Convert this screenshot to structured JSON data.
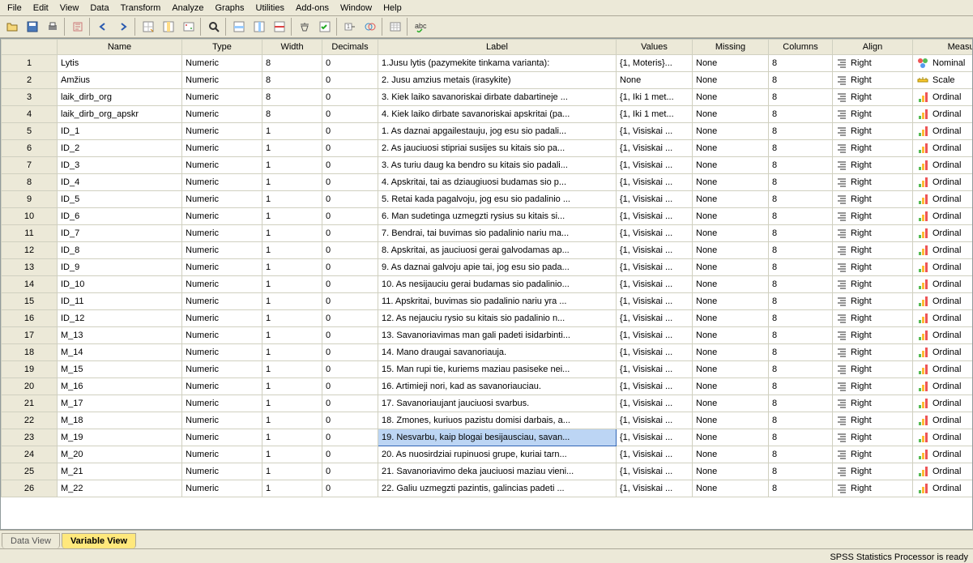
{
  "menu": [
    "File",
    "Edit",
    "View",
    "Data",
    "Transform",
    "Analyze",
    "Graphs",
    "Utilities",
    "Add-ons",
    "Window",
    "Help"
  ],
  "columns": [
    "Name",
    "Type",
    "Width",
    "Decimals",
    "Label",
    "Values",
    "Missing",
    "Columns",
    "Align",
    "Measure"
  ],
  "rows": [
    {
      "n": "1",
      "name": "Lytis",
      "type": "Numeric",
      "width": "8",
      "dec": "0",
      "label": "1.Jusu lytis (pazymekite tinkama varianta):",
      "values": "{1, Moteris}...",
      "missing": "None",
      "cols": "8",
      "align": "Right",
      "measure": "Nominal",
      "micon": "nominal"
    },
    {
      "n": "2",
      "name": "Amžius",
      "type": "Numeric",
      "width": "8",
      "dec": "0",
      "label": "2. Jusu amzius metais (irasykite)",
      "values": "None",
      "missing": "None",
      "cols": "8",
      "align": "Right",
      "measure": "Scale",
      "micon": "scale"
    },
    {
      "n": "3",
      "name": "laik_dirb_org",
      "type": "Numeric",
      "width": "8",
      "dec": "0",
      "label": "3. Kiek laiko savanoriskai dirbate dabartineje ...",
      "values": "{1, Iki 1 met...",
      "missing": "None",
      "cols": "8",
      "align": "Right",
      "measure": "Ordinal",
      "micon": "ordinal"
    },
    {
      "n": "4",
      "name": "laik_dirb_org_apskr",
      "type": "Numeric",
      "width": "8",
      "dec": "0",
      "label": "4. Kiek laiko dirbate savanoriskai apskritai (pa...",
      "values": "{1, Iki 1 met...",
      "missing": "None",
      "cols": "8",
      "align": "Right",
      "measure": "Ordinal",
      "micon": "ordinal"
    },
    {
      "n": "5",
      "name": "ID_1",
      "type": "Numeric",
      "width": "1",
      "dec": "0",
      "label": "1. As daznai apgailestauju, jog esu sio padali...",
      "values": "{1, Visiskai ...",
      "missing": "None",
      "cols": "8",
      "align": "Right",
      "measure": "Ordinal",
      "micon": "ordinal"
    },
    {
      "n": "6",
      "name": "ID_2",
      "type": "Numeric",
      "width": "1",
      "dec": "0",
      "label": "2. As jauciuosi stipriai susijes su kitais sio pa...",
      "values": "{1, Visiskai ...",
      "missing": "None",
      "cols": "8",
      "align": "Right",
      "measure": "Ordinal",
      "micon": "ordinal"
    },
    {
      "n": "7",
      "name": "ID_3",
      "type": "Numeric",
      "width": "1",
      "dec": "0",
      "label": "3. As turiu daug ka bendro su kitais sio padali...",
      "values": "{1, Visiskai ...",
      "missing": "None",
      "cols": "8",
      "align": "Right",
      "measure": "Ordinal",
      "micon": "ordinal"
    },
    {
      "n": "8",
      "name": "ID_4",
      "type": "Numeric",
      "width": "1",
      "dec": "0",
      "label": "4. Apskritai, tai as dziaugiuosi budamas sio p...",
      "values": "{1, Visiskai ...",
      "missing": "None",
      "cols": "8",
      "align": "Right",
      "measure": "Ordinal",
      "micon": "ordinal"
    },
    {
      "n": "9",
      "name": "ID_5",
      "type": "Numeric",
      "width": "1",
      "dec": "0",
      "label": "5. Retai kada pagalvoju, jog esu sio padalinio ...",
      "values": "{1, Visiskai ...",
      "missing": "None",
      "cols": "8",
      "align": "Right",
      "measure": "Ordinal",
      "micon": "ordinal"
    },
    {
      "n": "10",
      "name": "ID_6",
      "type": "Numeric",
      "width": "1",
      "dec": "0",
      "label": "6. Man sudetinga uzmegzti rysius su kitais si...",
      "values": "{1, Visiskai ...",
      "missing": "None",
      "cols": "8",
      "align": "Right",
      "measure": "Ordinal",
      "micon": "ordinal"
    },
    {
      "n": "11",
      "name": "ID_7",
      "type": "Numeric",
      "width": "1",
      "dec": "0",
      "label": "7. Bendrai, tai buvimas sio padalinio nariu ma...",
      "values": "{1, Visiskai ...",
      "missing": "None",
      "cols": "8",
      "align": "Right",
      "measure": "Ordinal",
      "micon": "ordinal"
    },
    {
      "n": "12",
      "name": "ID_8",
      "type": "Numeric",
      "width": "1",
      "dec": "0",
      "label": "8. Apskritai, as jauciuosi gerai galvodamas ap...",
      "values": "{1, Visiskai ...",
      "missing": "None",
      "cols": "8",
      "align": "Right",
      "measure": "Ordinal",
      "micon": "ordinal"
    },
    {
      "n": "13",
      "name": "ID_9",
      "type": "Numeric",
      "width": "1",
      "dec": "0",
      "label": "9. As daznai galvoju apie tai, jog esu sio pada...",
      "values": "{1, Visiskai ...",
      "missing": "None",
      "cols": "8",
      "align": "Right",
      "measure": "Ordinal",
      "micon": "ordinal"
    },
    {
      "n": "14",
      "name": "ID_10",
      "type": "Numeric",
      "width": "1",
      "dec": "0",
      "label": "10. As nesijauciu gerai budamas sio padalinio...",
      "values": "{1, Visiskai ...",
      "missing": "None",
      "cols": "8",
      "align": "Right",
      "measure": "Ordinal",
      "micon": "ordinal"
    },
    {
      "n": "15",
      "name": "ID_11",
      "type": "Numeric",
      "width": "1",
      "dec": "0",
      "label": "11. Apskritai, buvimas sio padalinio nariu yra ...",
      "values": "{1, Visiskai ...",
      "missing": "None",
      "cols": "8",
      "align": "Right",
      "measure": "Ordinal",
      "micon": "ordinal"
    },
    {
      "n": "16",
      "name": "ID_12",
      "type": "Numeric",
      "width": "1",
      "dec": "0",
      "label": "12. As nejauciu rysio su kitais sio padalinio n...",
      "values": "{1, Visiskai ...",
      "missing": "None",
      "cols": "8",
      "align": "Right",
      "measure": "Ordinal",
      "micon": "ordinal"
    },
    {
      "n": "17",
      "name": "M_13",
      "type": "Numeric",
      "width": "1",
      "dec": "0",
      "label": "13. Savanoriavimas  man gali padeti isidarbinti...",
      "values": "{1, Visiskai ...",
      "missing": "None",
      "cols": "8",
      "align": "Right",
      "measure": "Ordinal",
      "micon": "ordinal"
    },
    {
      "n": "18",
      "name": "M_14",
      "type": "Numeric",
      "width": "1",
      "dec": "0",
      "label": "14. Mano draugai savanoriauja.",
      "values": "{1, Visiskai ...",
      "missing": "None",
      "cols": "8",
      "align": "Right",
      "measure": "Ordinal",
      "micon": "ordinal"
    },
    {
      "n": "19",
      "name": "M_15",
      "type": "Numeric",
      "width": "1",
      "dec": "0",
      "label": "15. Man rupi tie, kuriems maziau pasiseke nei...",
      "values": "{1, Visiskai ...",
      "missing": "None",
      "cols": "8",
      "align": "Right",
      "measure": "Ordinal",
      "micon": "ordinal"
    },
    {
      "n": "20",
      "name": "M_16",
      "type": "Numeric",
      "width": "1",
      "dec": "0",
      "label": "16. Artimieji nori, kad as savanoriauciau.",
      "values": "{1, Visiskai ...",
      "missing": "None",
      "cols": "8",
      "align": "Right",
      "measure": "Ordinal",
      "micon": "ordinal"
    },
    {
      "n": "21",
      "name": "M_17",
      "type": "Numeric",
      "width": "1",
      "dec": "0",
      "label": "17. Savanoriaujant jauciuosi svarbus.",
      "values": "{1, Visiskai ...",
      "missing": "None",
      "cols": "8",
      "align": "Right",
      "measure": "Ordinal",
      "micon": "ordinal"
    },
    {
      "n": "22",
      "name": "M_18",
      "type": "Numeric",
      "width": "1",
      "dec": "0",
      "label": "18. Zmones, kuriuos pazistu domisi darbais, a...",
      "values": "{1, Visiskai ...",
      "missing": "None",
      "cols": "8",
      "align": "Right",
      "measure": "Ordinal",
      "micon": "ordinal"
    },
    {
      "n": "23",
      "name": "M_19",
      "type": "Numeric",
      "width": "1",
      "dec": "0",
      "label": "19. Nesvarbu, kaip blogai besijausciau, savan...",
      "values": "{1, Visiskai ...",
      "missing": "None",
      "cols": "8",
      "align": "Right",
      "measure": "Ordinal",
      "micon": "ordinal",
      "sel": true
    },
    {
      "n": "24",
      "name": "M_20",
      "type": "Numeric",
      "width": "1",
      "dec": "0",
      "label": "20. As nuosirdziai rupinuosi  grupe, kuriai tarn...",
      "values": "{1, Visiskai ...",
      "missing": "None",
      "cols": "8",
      "align": "Right",
      "measure": "Ordinal",
      "micon": "ordinal"
    },
    {
      "n": "25",
      "name": "M_21",
      "type": "Numeric",
      "width": "1",
      "dec": "0",
      "label": "21. Savanoriavimo deka jauciuosi maziau vieni...",
      "values": "{1, Visiskai ...",
      "missing": "None",
      "cols": "8",
      "align": "Right",
      "measure": "Ordinal",
      "micon": "ordinal"
    },
    {
      "n": "26",
      "name": "M_22",
      "type": "Numeric",
      "width": "1",
      "dec": "0",
      "label": "22. Galiu  uzmegzti pazintis, galincias padeti ...",
      "values": "{1, Visiskai ...",
      "missing": "None",
      "cols": "8",
      "align": "Right",
      "measure": "Ordinal",
      "micon": "ordinal"
    }
  ],
  "tabs": {
    "data": "Data View",
    "variable": "Variable View"
  },
  "status": "SPSS Statistics Processor is ready"
}
